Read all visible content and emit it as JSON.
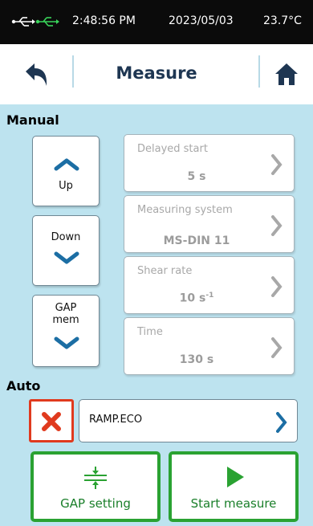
{
  "status_bar": {
    "usb_icon": "usb-icon",
    "time": "2:48:56 PM",
    "date": "2023/05/03",
    "temperature": "23.7°C"
  },
  "title_bar": {
    "back_icon": "back-arrow-icon",
    "title": "Measure",
    "home_icon": "home-icon"
  },
  "manual": {
    "label": "Manual",
    "buttons": [
      {
        "label": "Up",
        "icon": "chevron-up-icon"
      },
      {
        "label": "Down",
        "icon": "chevron-down-icon"
      },
      {
        "label": "GAP\nmem",
        "line1": "GAP",
        "line2": "mem",
        "icon": "chevron-down-icon"
      }
    ],
    "parameters": [
      {
        "label": "Delayed start",
        "value": "5 s"
      },
      {
        "label": "Measuring system",
        "value": "MS-DIN 11"
      },
      {
        "label": "Shear rate",
        "value": "10 s",
        "value_sup": "-1"
      },
      {
        "label": "Time",
        "value": "130 s"
      }
    ]
  },
  "auto": {
    "label": "Auto",
    "program": "RAMP.ECO",
    "cancel_icon": "close-icon"
  },
  "actions": {
    "gap_setting": "GAP setting",
    "start_measure": "Start measure"
  },
  "colors": {
    "status_bg": "#0b0b0b",
    "usb_green": "#39d45a",
    "title_text": "#1e3652",
    "panel_bg": "#bde3ef",
    "accent_blue": "#1c6ea4",
    "cancel_red": "#e03a1e",
    "action_green": "#2aa232"
  }
}
